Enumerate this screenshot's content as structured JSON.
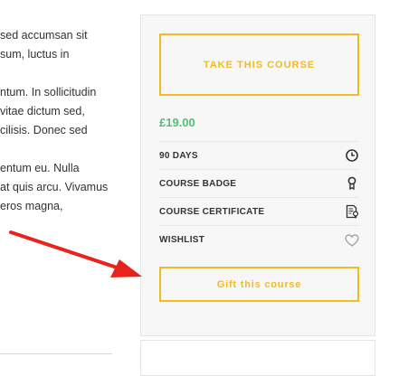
{
  "article": {
    "paragraphs": [
      [
        "sed accumsan sit",
        "sum, luctus in"
      ],
      [
        "ntum. In sollicitudin",
        "vitae dictum sed,",
        "cilisis. Donec sed"
      ],
      [
        "entum eu. Nulla",
        "at quis arcu. Vivamus",
        " eros magna,"
      ]
    ]
  },
  "course": {
    "take_label": "TAKE THIS COURSE",
    "price": "£19.00",
    "features": [
      {
        "label": "90 DAYS",
        "icon": "clock-icon"
      },
      {
        "label": "COURSE BADGE",
        "icon": "badge-icon"
      },
      {
        "label": "COURSE CERTIFICATE",
        "icon": "certificate-icon"
      },
      {
        "label": "WISHLIST",
        "icon": "heart-icon"
      }
    ],
    "gift_label": "Gift this course"
  },
  "colors": {
    "accent": "#f2bb22",
    "price": "#53bf72",
    "annotation_arrow": "#e8231c"
  }
}
